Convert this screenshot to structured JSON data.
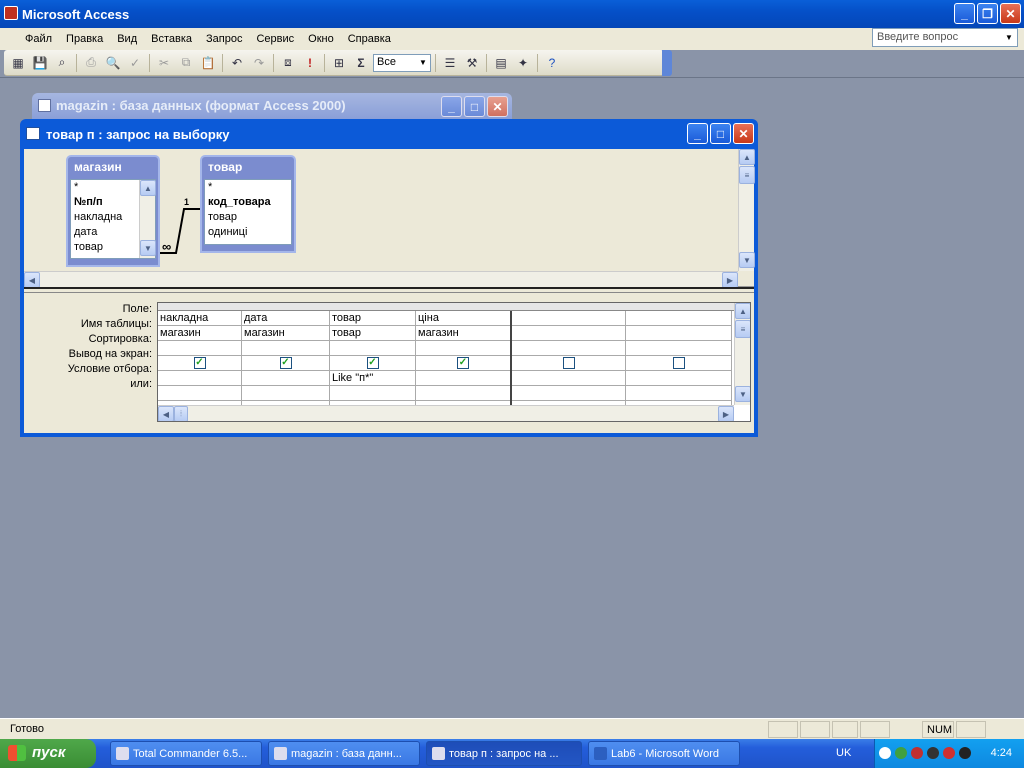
{
  "app": {
    "title": "Microsoft Access"
  },
  "menu": [
    "Файл",
    "Правка",
    "Вид",
    "Вставка",
    "Запрос",
    "Сервис",
    "Окно",
    "Справка"
  ],
  "help_box": {
    "placeholder": "Введите вопрос"
  },
  "toolbar": {
    "top_values": "Все",
    "sum_symbol": "Σ",
    "run_symbol": "!"
  },
  "db_window": {
    "title": "magazin : база данных (формат Access 2000)"
  },
  "query_window": {
    "title": "товар п : запрос на выборку"
  },
  "tables": [
    {
      "name": "магазин",
      "fields": [
        "*",
        "№п/п",
        "накладна",
        "дата",
        "товар"
      ],
      "key_index": 1
    },
    {
      "name": "товар",
      "fields": [
        "*",
        "код_товара",
        "товар",
        "одиниці"
      ],
      "key_index": 1
    }
  ],
  "relation": {
    "one_label": "1",
    "many_label": "∞"
  },
  "grid": {
    "row_labels": [
      "Поле:",
      "Имя таблицы:",
      "Сортировка:",
      "Вывод на экран:",
      "Условие отбора:",
      "или:"
    ],
    "columns": [
      {
        "field": "накладна",
        "table": "магазин",
        "sort": "",
        "show": true,
        "criteria": "",
        "or": ""
      },
      {
        "field": "дата",
        "table": "магазин",
        "sort": "",
        "show": true,
        "criteria": "",
        "or": ""
      },
      {
        "field": "товар",
        "table": "товар",
        "sort": "",
        "show": true,
        "criteria": "Like \"п*\"",
        "or": ""
      },
      {
        "field": "ціна",
        "table": "магазин",
        "sort": "",
        "show": true,
        "criteria": "",
        "or": ""
      },
      {
        "field": "",
        "table": "",
        "sort": "",
        "show": false,
        "criteria": "",
        "or": ""
      },
      {
        "field": "",
        "table": "",
        "sort": "",
        "show": false,
        "criteria": "",
        "or": ""
      }
    ]
  },
  "status": {
    "text": "Готово",
    "num": "NUM"
  },
  "taskbar": {
    "start_label": "пуск",
    "tasks": [
      "Total Commander 6.5...",
      "magazin : база данн...",
      "товар п : запрос на ...",
      "Lab6 - Microsoft Word"
    ],
    "active_index": 2,
    "lang": "UK",
    "clock": "4:24"
  },
  "colors": {
    "title_bar": "#0550c8",
    "workspace": "#8a94a8",
    "table_header": "#7b8ccf",
    "check": "#21a121"
  }
}
